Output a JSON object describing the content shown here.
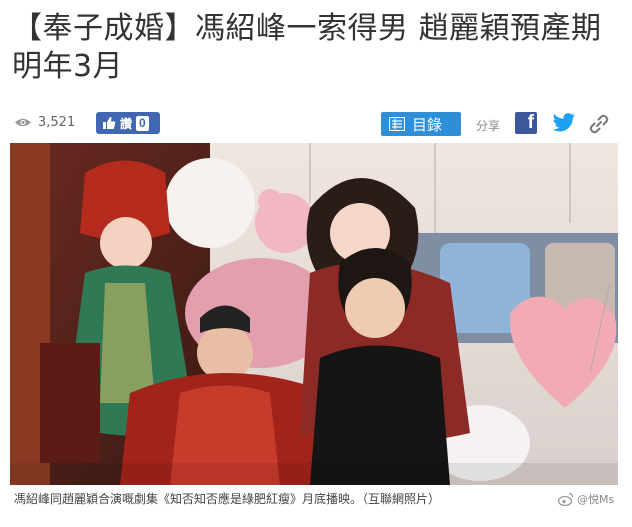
{
  "article": {
    "headline": "【奉子成婚】馮紹峰一索得男 趙麗穎預產期明年3月",
    "views": "3,521",
    "like_label": "讚",
    "like_count": "0",
    "toc_label": "目錄",
    "share_label": "分享",
    "fb_letter": "f",
    "caption": "馮紹峰同趙麗穎合演嘅劇集《知否知否應是綠肥紅瘦》月底播映。（互聯網照片）",
    "watermark": "@悦Ms"
  },
  "icons": {
    "views": "eye-icon",
    "like": "thumbs-up-icon",
    "toc": "list-icon",
    "facebook": "facebook-icon",
    "twitter": "twitter-icon",
    "link": "link-icon",
    "watermark": "weibo-icon"
  },
  "colors": {
    "like_button": "#4267b2",
    "toc_button": "#2f8ed8",
    "facebook": "#3b5998",
    "twitter": "#1da1f2"
  }
}
